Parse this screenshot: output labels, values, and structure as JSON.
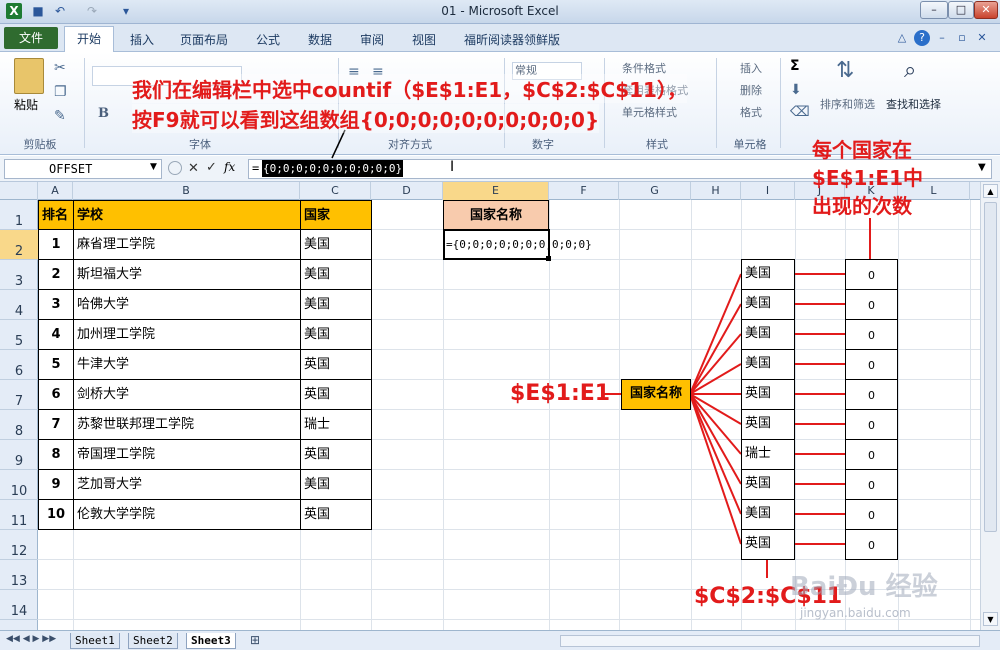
{
  "window": {
    "title": "01 - Microsoft Excel",
    "quick_access": {
      "save": "■",
      "undo": "↶",
      "redo": "↷",
      "customize": "▾"
    },
    "buttons": {
      "help": "?",
      "minimize": "–",
      "restore": "□",
      "close": "✕"
    },
    "colors": {
      "file_tab": "#2f6b2f",
      "header_fill": "#ffc000",
      "annotation_red": "#e21b1b",
      "label_fill": "#f8cbad"
    }
  },
  "ribbon": {
    "tabs": [
      "文件",
      "开始",
      "插入",
      "页面布局",
      "公式",
      "数据",
      "审阅",
      "视图",
      "福昕阅读器领鲜版"
    ],
    "groups": {
      "clipboard": {
        "paste": "粘贴",
        "label": "剪贴板"
      },
      "font": {
        "label": "字体",
        "bold": "B"
      },
      "alignment": {
        "label": "对齐方式"
      },
      "number": {
        "format": "常规",
        "label": "数字"
      },
      "styles": {
        "conditional": "条件格式",
        "table": "套用表格格式",
        "cell": "单元格样式",
        "label": "样式"
      },
      "cells": {
        "insert": "插入",
        "delete": "删除",
        "format": "格式",
        "label": "单元格"
      },
      "editing": {
        "sum": "Σ",
        "sort": "排序和筛选",
        "find": "查找和选择"
      }
    }
  },
  "formula_bar": {
    "name_box": "OFFSET",
    "cancel": "✕",
    "enter": "✓",
    "fx": "fx",
    "eq": "=",
    "selected_text": "{0;0;0;0;0;0;0;0;0;0}"
  },
  "grid": {
    "columns": [
      "A",
      "B",
      "C",
      "D",
      "E",
      "F",
      "G",
      "H",
      "I",
      "J",
      "K",
      "L"
    ],
    "rows": [
      "1",
      "2",
      "3",
      "4",
      "5",
      "6",
      "7",
      "8",
      "9",
      "10",
      "11",
      "12",
      "13",
      "14"
    ],
    "table": {
      "headers": [
        "排名",
        "学校",
        "国家"
      ],
      "rows": [
        [
          "1",
          "麻省理工学院",
          "美国"
        ],
        [
          "2",
          "斯坦福大学",
          "美国"
        ],
        [
          "3",
          "哈佛大学",
          "美国"
        ],
        [
          "4",
          "加州理工学院",
          "美国"
        ],
        [
          "5",
          "牛津大学",
          "英国"
        ],
        [
          "6",
          "剑桥大学",
          "英国"
        ],
        [
          "7",
          "苏黎世联邦理工学院",
          "瑞士"
        ],
        [
          "8",
          "帝国理工学院",
          "英国"
        ],
        [
          "9",
          "芝加哥大学",
          "美国"
        ],
        [
          "10",
          "伦敦大学学院",
          "英国"
        ]
      ]
    },
    "e1_label": "国家名称",
    "e2_value": "={0;0;0;0;0;0;0;0;0;0}"
  },
  "diagram": {
    "center_label": "国家名称",
    "countries": [
      "美国",
      "美国",
      "美国",
      "美国",
      "英国",
      "英国",
      "瑞士",
      "英国",
      "美国",
      "英国"
    ],
    "counts": [
      "0",
      "0",
      "0",
      "0",
      "0",
      "0",
      "0",
      "0",
      "0",
      "0"
    ]
  },
  "annotations": {
    "top_line1": "我们在编辑栏中选中countif（$E$1:E1，$C$2:$C$11），",
    "top_line2": "按F9就可以看到这组数组{0;0;0;0;0;0;0;0;0;0}",
    "right_line1": "每个国家在",
    "right_line2": "$E$1:E1中",
    "right_line3": "出现的次数",
    "left_label": "$E$1:E1",
    "bottom_label": "$C$2:$C$11"
  },
  "sheets": [
    "Sheet1",
    "Sheet2",
    "Sheet3"
  ],
  "watermark": {
    "text": "BaiÐu 经验",
    "url": "jingyan.baidu.com"
  }
}
